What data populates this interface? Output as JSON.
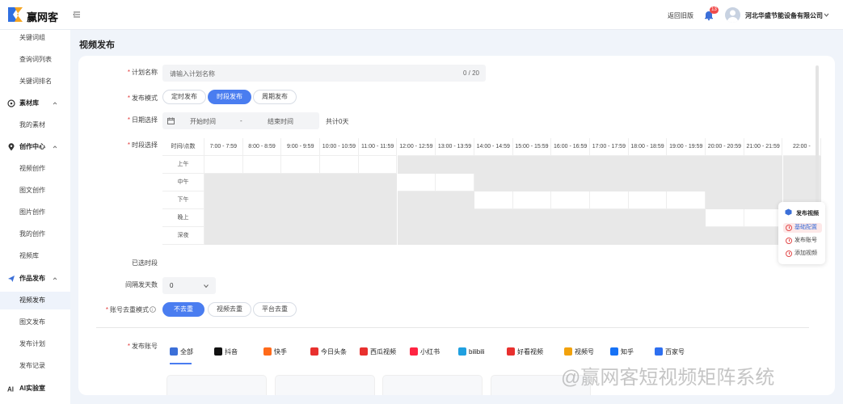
{
  "header": {
    "logo_text": "赢网客",
    "back_label": "返回旧版",
    "badge_count": "13",
    "company": "河北华盛节能设备有限公司",
    "icons": [
      "menu-toggle-icon",
      "bell-icon",
      "avatar",
      "chevron-down-icon"
    ]
  },
  "sidebar": {
    "items": [
      {
        "label": "关键词组",
        "kind": "item"
      },
      {
        "label": "查询词列表",
        "kind": "item"
      },
      {
        "label": "关键词排名",
        "kind": "item"
      },
      {
        "label": "素材库",
        "kind": "group",
        "icon": "aperture-icon"
      },
      {
        "label": "我的素材",
        "kind": "item"
      },
      {
        "label": "创作中心",
        "kind": "group",
        "icon": "location-icon"
      },
      {
        "label": "视频创作",
        "kind": "item"
      },
      {
        "label": "图文创作",
        "kind": "item"
      },
      {
        "label": "图片创作",
        "kind": "item"
      },
      {
        "label": "我的创作",
        "kind": "item"
      },
      {
        "label": "视频库",
        "kind": "item"
      },
      {
        "label": "作品发布",
        "kind": "group",
        "icon": "send-icon"
      },
      {
        "label": "视频发布",
        "kind": "item",
        "active": true
      },
      {
        "label": "图文发布",
        "kind": "item"
      },
      {
        "label": "发布计划",
        "kind": "item"
      },
      {
        "label": "发布记录",
        "kind": "item"
      },
      {
        "label": "AI实验室",
        "kind": "group",
        "icon": "ai-icon"
      }
    ]
  },
  "page": {
    "title": "视频发布"
  },
  "form": {
    "plan_name": {
      "label": "计划名称",
      "placeholder": "请输入计划名称",
      "count": "0 / 20"
    },
    "publish_mode": {
      "label": "发布模式",
      "options": [
        "定时发布",
        "时段发布",
        "周期发布"
      ],
      "selected": "时段发布"
    },
    "date_range": {
      "label": "日期选择",
      "start_placeholder": "开始时间",
      "separator": "-",
      "end_placeholder": "结束时间",
      "total": "共计0天"
    },
    "time_slot": {
      "label": "时段选择",
      "corner": "时间/点数",
      "columns": [
        "7:00 - 7:59",
        "8:00 - 8:59",
        "9:00 - 9:59",
        "10:00 - 10:59",
        "11:00 - 11:59",
        "12:00 - 12:59",
        "13:00 - 13:59",
        "14:00 - 14:59",
        "15:00 - 15:59",
        "16:00 - 16:59",
        "17:00 - 17:59",
        "18:00 - 18:59",
        "19:00 - 19:59",
        "20:00 - 20:59",
        "21:00 - 21:59",
        "22:00 -"
      ],
      "rows": [
        "上午",
        "中午",
        "下午",
        "晚上",
        "深夜"
      ],
      "available": [
        [
          1,
          1,
          1,
          1,
          1,
          0,
          0,
          0,
          0,
          0,
          0,
          0,
          0,
          0,
          0,
          0
        ],
        [
          0,
          0,
          0,
          0,
          0,
          1,
          1,
          0,
          0,
          0,
          0,
          0,
          0,
          0,
          0,
          0
        ],
        [
          0,
          0,
          0,
          0,
          0,
          0,
          0,
          1,
          1,
          1,
          1,
          1,
          1,
          0,
          0,
          0
        ],
        [
          0,
          0,
          0,
          0,
          0,
          0,
          0,
          0,
          0,
          0,
          0,
          0,
          0,
          1,
          1,
          0
        ],
        [
          0,
          0,
          0,
          0,
          0,
          0,
          0,
          0,
          0,
          0,
          0,
          0,
          0,
          0,
          0,
          0
        ]
      ]
    },
    "selected_slots": {
      "label": "已选时段"
    },
    "interval_days": {
      "label": "间隔发天数",
      "value": "0"
    },
    "dedup_mode": {
      "label": "账号去重模式",
      "options": [
        "不去重",
        "视频去重",
        "平台去重"
      ],
      "selected": "不去重"
    },
    "publish_accounts": {
      "label": "发布账号",
      "platforms": [
        {
          "label": "全部",
          "color": "#3b6fd8"
        },
        {
          "label": "抖音",
          "color": "#111111"
        },
        {
          "label": "快手",
          "color": "#ff6a1a"
        },
        {
          "label": "今日头条",
          "color": "#e8302e"
        },
        {
          "label": "西瓜视频",
          "color": "#e8302e"
        },
        {
          "label": "小红书",
          "color": "#ff2442"
        },
        {
          "label": "bilibili",
          "color": "#20a0e0"
        },
        {
          "label": "好看视频",
          "color": "#e8302e"
        },
        {
          "label": "视频号",
          "color": "#f2a20c"
        },
        {
          "label": "知乎",
          "color": "#1772f6"
        },
        {
          "label": "百家号",
          "color": "#2d6ff0"
        }
      ]
    }
  },
  "float_nav": {
    "title": "发布视频",
    "items": [
      {
        "label": "基础配置",
        "active": true
      },
      {
        "label": "发布账号"
      },
      {
        "label": "添加视频"
      }
    ]
  },
  "watermark": "@赢网客短视频矩阵系统",
  "colors": {
    "accent": "#4a7df0",
    "required": "#e23c3c",
    "badge": "#f04b4b"
  }
}
